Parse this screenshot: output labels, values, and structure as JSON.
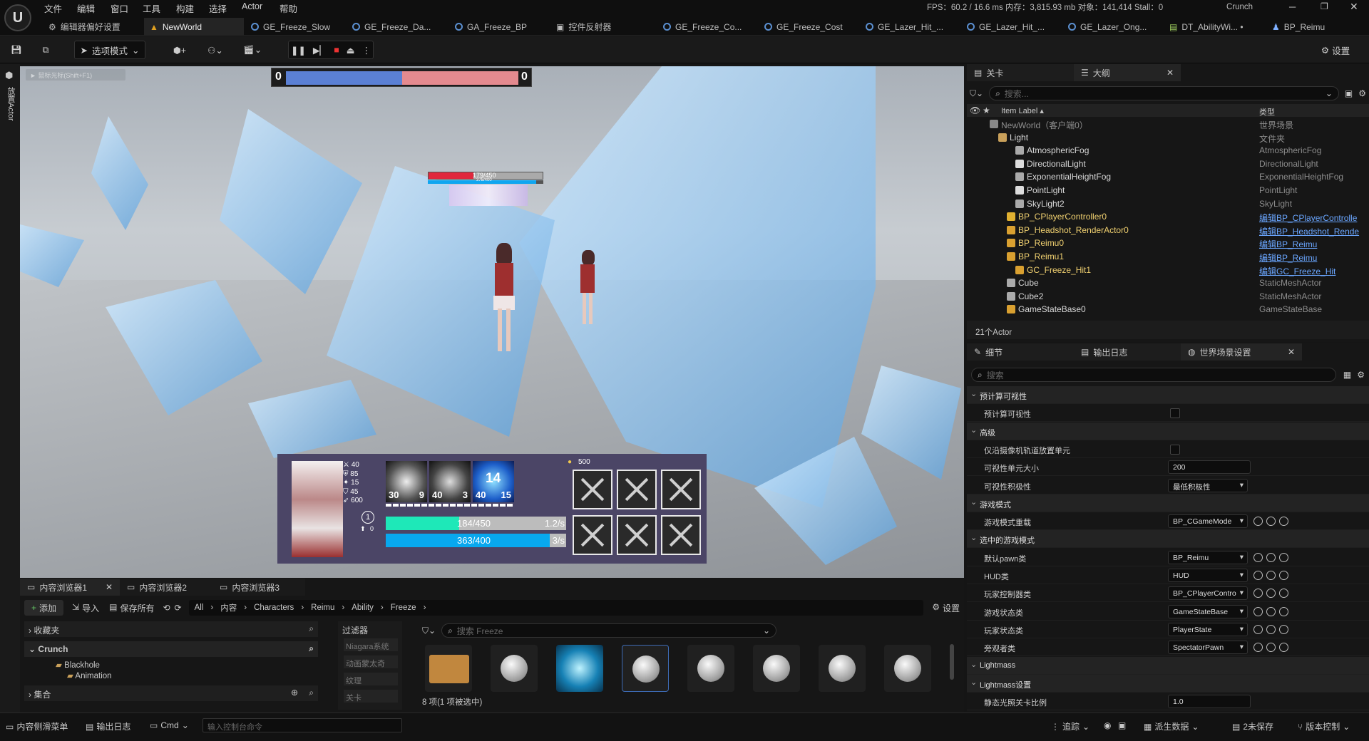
{
  "menu": [
    "文件",
    "编辑",
    "窗口",
    "工具",
    "构建",
    "选择",
    "Actor",
    "帮助"
  ],
  "tabs": [
    {
      "label": "编辑器偏好设置"
    },
    {
      "label": "NewWorld"
    },
    {
      "label": "GE_Freeze_Slow"
    },
    {
      "label": "GE_Freeze_Da..."
    },
    {
      "label": "GA_Freeze_BP"
    },
    {
      "label": "控件反射器"
    },
    {
      "label": "GE_Freeze_Co..."
    },
    {
      "label": "GE_Freeze_Cost"
    },
    {
      "label": "GE_Lazer_Hit_..."
    },
    {
      "label": "GE_Lazer_Hit_..."
    },
    {
      "label": "GE_Lazer_Ong..."
    },
    {
      "label": "DT_AbilityWi... •"
    },
    {
      "label": "BP_Reimu"
    }
  ],
  "stats": {
    "text": "FPS：60.2 / 16.6 ms  内存：3,815.93 mb  对象：141,414  Stall：0",
    "project": "Crunch"
  },
  "toolbar": {
    "mode_label": "选项模式",
    "settings_label": "设置"
  },
  "left_strip": {
    "label": "放置Actor"
  },
  "viewport": {
    "hint": "► 鼠标光标(Shift+F1)",
    "score_left": "0",
    "score_right": "0",
    "enemy_health": "179/450",
    "enemy_mana": "375/400",
    "hud": {
      "stats": [
        "40",
        "85",
        "15",
        "45",
        "600"
      ],
      "level": "1",
      "level_sub": "0",
      "skills": [
        {
          "cost": "30",
          "cooldown": "9"
        },
        {
          "cost": "40",
          "cooldown": "3"
        },
        {
          "cost": "40",
          "cooldown": "15",
          "timer": "14"
        }
      ],
      "gold": "500",
      "health": "184/450",
      "health_regen": "1.2/s",
      "health_frac": 0.409,
      "mana": "363/400",
      "mana_regen": "3/s",
      "mana_frac": 0.9075
    }
  },
  "outliner": {
    "tab_left": "关卡",
    "tab_main": "大纲",
    "search_placeholder": "搜索...",
    "col_label": "Item Label ▴",
    "col_type": "类型",
    "rows": [
      {
        "label": "NewWorld（客户端0）",
        "type": "世界场景"
      },
      {
        "label": "Light",
        "type": "文件夹"
      },
      {
        "label": "AtmosphericFog",
        "type": "AtmosphericFog"
      },
      {
        "label": "DirectionalLight",
        "type": "DirectionalLight"
      },
      {
        "label": "ExponentialHeightFog",
        "type": "ExponentialHeightFog"
      },
      {
        "label": "PointLight",
        "type": "PointLight"
      },
      {
        "label": "SkyLight2",
        "type": "SkyLight"
      },
      {
        "label": "BP_CPlayerController0",
        "type": "编辑BP_CPlayerControlle"
      },
      {
        "label": "BP_Headshot_RenderActor0",
        "type": "编辑BP_Headshot_Rende"
      },
      {
        "label": "BP_Reimu0",
        "type": "编辑BP_Reimu"
      },
      {
        "label": "BP_Reimu1",
        "type": "编辑BP_Reimu"
      },
      {
        "label": "GC_Freeze_Hit1",
        "type": "编辑GC_Freeze_Hit"
      },
      {
        "label": "Cube",
        "type": "StaticMeshActor"
      },
      {
        "label": "Cube2",
        "type": "StaticMeshActor"
      },
      {
        "label": "GameStateBase0",
        "type": "GameStateBase"
      }
    ],
    "count": "21个Actor"
  },
  "details": {
    "tab1": "细节",
    "tab2": "输出日志",
    "tab3": "世界场景设置",
    "search_placeholder": "搜索",
    "rows": [
      {
        "k": "预计算可视性",
        "cat": true
      },
      {
        "k": "预计算可视性",
        "chk": true
      },
      {
        "k": "高级",
        "cat": true
      },
      {
        "k": "仅沿摄像机轨道放置单元",
        "chk": true
      },
      {
        "k": "可视性单元大小",
        "v": "200"
      },
      {
        "k": "可视性积极性",
        "v": "最低积极性",
        "combo": true
      },
      {
        "k": "游戏模式",
        "cat": true
      },
      {
        "k": "游戏模式重载",
        "v": "BP_CGameMode",
        "combo": true,
        "icons": true
      },
      {
        "k": "选中的游戏模式",
        "cat": true
      },
      {
        "k": "默认pawn类",
        "v": "BP_Reimu",
        "combo": true,
        "icons": true
      },
      {
        "k": "HUD类",
        "v": "HUD",
        "combo": true,
        "icons": true
      },
      {
        "k": "玩家控制器类",
        "v": "BP_CPlayerContro",
        "combo": true,
        "icons": true
      },
      {
        "k": "游戏状态类",
        "v": "GameStateBase",
        "combo": true,
        "icons": true
      },
      {
        "k": "玩家状态类",
        "v": "PlayerState",
        "combo": true,
        "icons": true
      },
      {
        "k": "旁观者类",
        "v": "SpectatorPawn",
        "combo": true,
        "icons": true
      },
      {
        "k": "Lightmass",
        "cat": true
      },
      {
        "k": "Lightmass设置",
        "cat": true
      },
      {
        "k": "静态光照关卡比例",
        "v": "1.0"
      }
    ]
  },
  "content": {
    "tabs": [
      "内容浏览器1",
      "内容浏览器2",
      "内容浏览器3"
    ],
    "add": "添加",
    "import": "导入",
    "save_all": "保存所有",
    "settings": "设置",
    "breadcrumb": [
      "All",
      "内容",
      "Characters",
      "Reimu",
      "Ability",
      "Freeze"
    ],
    "favorites": "收藏夹",
    "project": "Crunch",
    "collections": "集合",
    "tree": [
      "Blackhole",
      "Animation"
    ],
    "filters_title": "过滤器",
    "filters": [
      "Niagara系统",
      "动画蒙太奇",
      "纹理",
      "关卡"
    ],
    "search_placeholder": "搜索 Freeze",
    "status": "8 项(1 项被选中)"
  },
  "statusbar": {
    "drawer": "内容侧滑菜单",
    "log": "输出日志",
    "cmd": "Cmd",
    "cmd_placeholder": "输入控制台命令",
    "trace": "追踪",
    "derived": "派生数据",
    "unsaved": "2未保存",
    "source": "版本控制"
  }
}
